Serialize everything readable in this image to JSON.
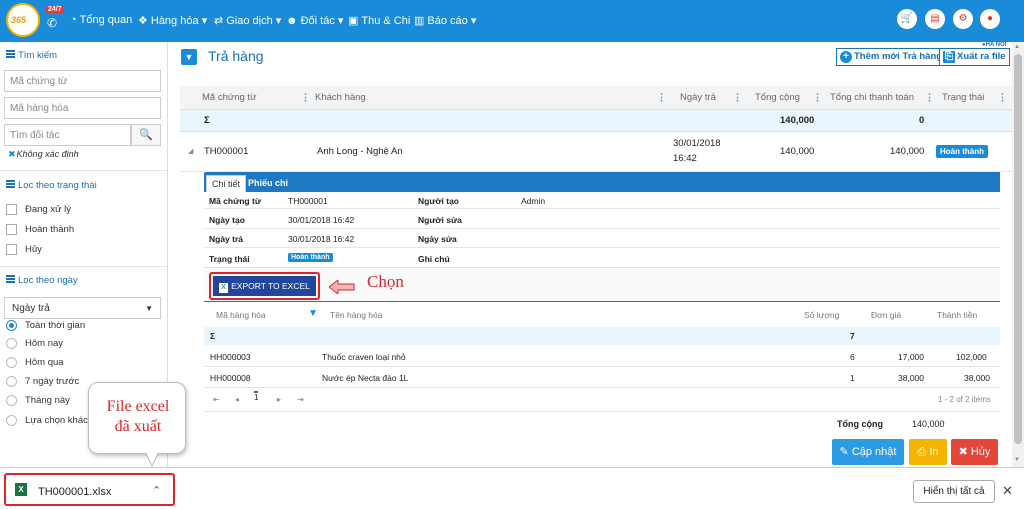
{
  "topnav": {
    "logo": "365",
    "hotline_badge": "24/7",
    "items": [
      {
        "icon": "gauge-icon",
        "label": "Tổng quan"
      },
      {
        "icon": "cubes-icon",
        "label": "Hàng hóa"
      },
      {
        "icon": "exchange-icon",
        "label": "Giao dịch"
      },
      {
        "icon": "users-icon",
        "label": "Đối tác"
      },
      {
        "icon": "money-icon",
        "label": "Thu & Chi"
      },
      {
        "icon": "bar-chart-icon",
        "label": "Báo cáo"
      }
    ],
    "dropdown_marker": "▾"
  },
  "sidebar": {
    "search_title": "Tìm kiếm",
    "voucher_placeholder": "Mã chứng từ",
    "product_placeholder": "Mã hàng hóa",
    "partner_placeholder": "Tìm đối tác",
    "partner_note": "Không xác định",
    "status_title": "Lọc theo trạng thái",
    "status_options": [
      "Đang xử lý",
      "Hoàn thành",
      "Hủy"
    ],
    "date_title": "Lọc theo ngày",
    "date_field": "Ngày trả",
    "date_options": [
      "Toàn thời gian",
      "Hôm nay",
      "Hôm qua",
      "7 ngày trước",
      "Tháng này",
      "Lựa chọn khác"
    ],
    "date_selected": "Toàn thời gian"
  },
  "main": {
    "title": "Trả hàng",
    "location": "HA NOI",
    "add_button": "Thêm mới Trả hàng",
    "export_button": "Xuất ra file",
    "grid": {
      "columns": [
        "Mã chứng từ",
        "Khách hàng",
        "Ngày trả",
        "Tổng cộng",
        "Tổng chi thanh toán",
        "Trạng thái"
      ],
      "sum_symbol": "Σ",
      "sum_total": "140,000",
      "sum_paid": "0",
      "row": {
        "code": "TH000001",
        "customer": "Anh Long - Nghệ An",
        "date": "30/01/2018",
        "time": "16:42",
        "total": "140,000",
        "paid": "140,000",
        "status": "Hoàn thành"
      }
    },
    "detail": {
      "tab_detail": "Chi tiết",
      "tab_receipt": "Phiếu chi",
      "labels": {
        "code": "Mã chứng từ",
        "created_date": "Ngày tạo",
        "return_date": "Ngày trả",
        "status": "Trạng thái",
        "creator": "Người tạo",
        "editor": "Người sửa",
        "edit_date": "Ngày sửa",
        "note": "Ghi chú"
      },
      "values": {
        "code": "TH000001",
        "created_date": "30/01/2018 16:42",
        "return_date": "30/01/2018 16:42",
        "status": "Hoàn thành",
        "creator": "Admin"
      },
      "export_excel": "EXPORT TO EXCEL",
      "annotation": "Chọn",
      "products": {
        "columns": [
          "Mã hàng hóa",
          "Tên hàng hóa",
          "Số lượng",
          "Đơn giá",
          "Thành tiền"
        ],
        "sum_symbol": "Σ",
        "sum_qty": "7",
        "rows": [
          {
            "code": "HH000003",
            "name": "Thuốc craven loại nhỏ",
            "qty": "6",
            "price": "17,000",
            "amount": "102,000"
          },
          {
            "code": "HH000008",
            "name": "Nước ép Necta đào 1L",
            "qty": "1",
            "price": "38,000",
            "amount": "38,000"
          }
        ],
        "pager": {
          "first": "⇤",
          "prev": "◂",
          "page": "1",
          "next": "▸",
          "last": "⇥",
          "info": "1 - 2 of 2 items"
        }
      },
      "total_label": "Tổng cộng",
      "total_value": "140,000",
      "buttons": {
        "update": "Cập nhật",
        "print": "In",
        "cancel": "Hủy"
      }
    }
  },
  "callout": {
    "line1": "File excel",
    "line2": "đã xuất"
  },
  "download_bar": {
    "file_name": "TH000001.xlsx",
    "show_all": "Hiển thị tất cả",
    "close": "✕"
  },
  "colors": {
    "brand": "#1a8bd8",
    "export_button": "#22479a",
    "highlight": "#d9262c",
    "update_button": "#2b9be6",
    "print_button": "#f5b400",
    "cancel_button": "#e4473a"
  }
}
